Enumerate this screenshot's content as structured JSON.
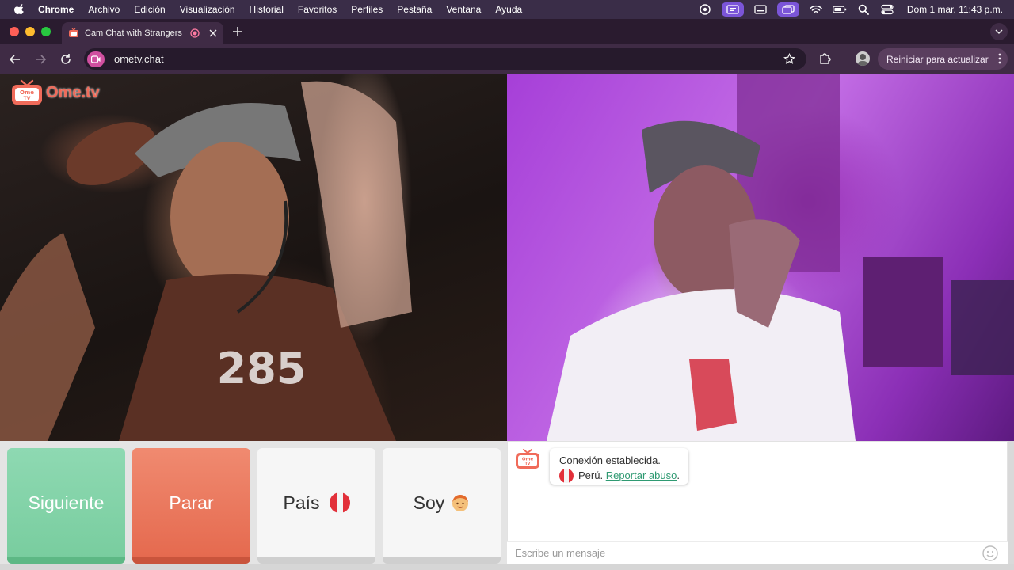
{
  "menubar": {
    "items": [
      "Chrome",
      "Archivo",
      "Edición",
      "Visualización",
      "Historial",
      "Favoritos",
      "Perfiles",
      "Pestaña",
      "Ventana",
      "Ayuda"
    ],
    "clock": "Dom 1 mar.  11:43 p.m."
  },
  "browser": {
    "tab_title": "Cam Chat with Strangers",
    "url": "ometv.chat",
    "update_label": "Reiniciar para actualizar"
  },
  "app": {
    "logo_text": "Ome.tv",
    "buttons": {
      "next": "Siguiente",
      "stop": "Parar",
      "country": "País",
      "me": "Soy"
    },
    "chat": {
      "status": "Conexión establecida.",
      "country": "Perú.",
      "report_link": "Reportar abuso",
      "report_suffix": ".",
      "input_placeholder": "Escribe un mensaje"
    },
    "shirt_text": "285"
  },
  "colors": {
    "next": "#79cd9f",
    "stop": "#e56a4f",
    "link": "#2f9a72",
    "menubar": "#3a2d48"
  },
  "icons": [
    "apple-icon",
    "back-icon",
    "forward-icon",
    "reload-icon",
    "star-icon",
    "extensions-icon",
    "peru-flag-icon",
    "boy-face-icon",
    "smiley-icon"
  ]
}
